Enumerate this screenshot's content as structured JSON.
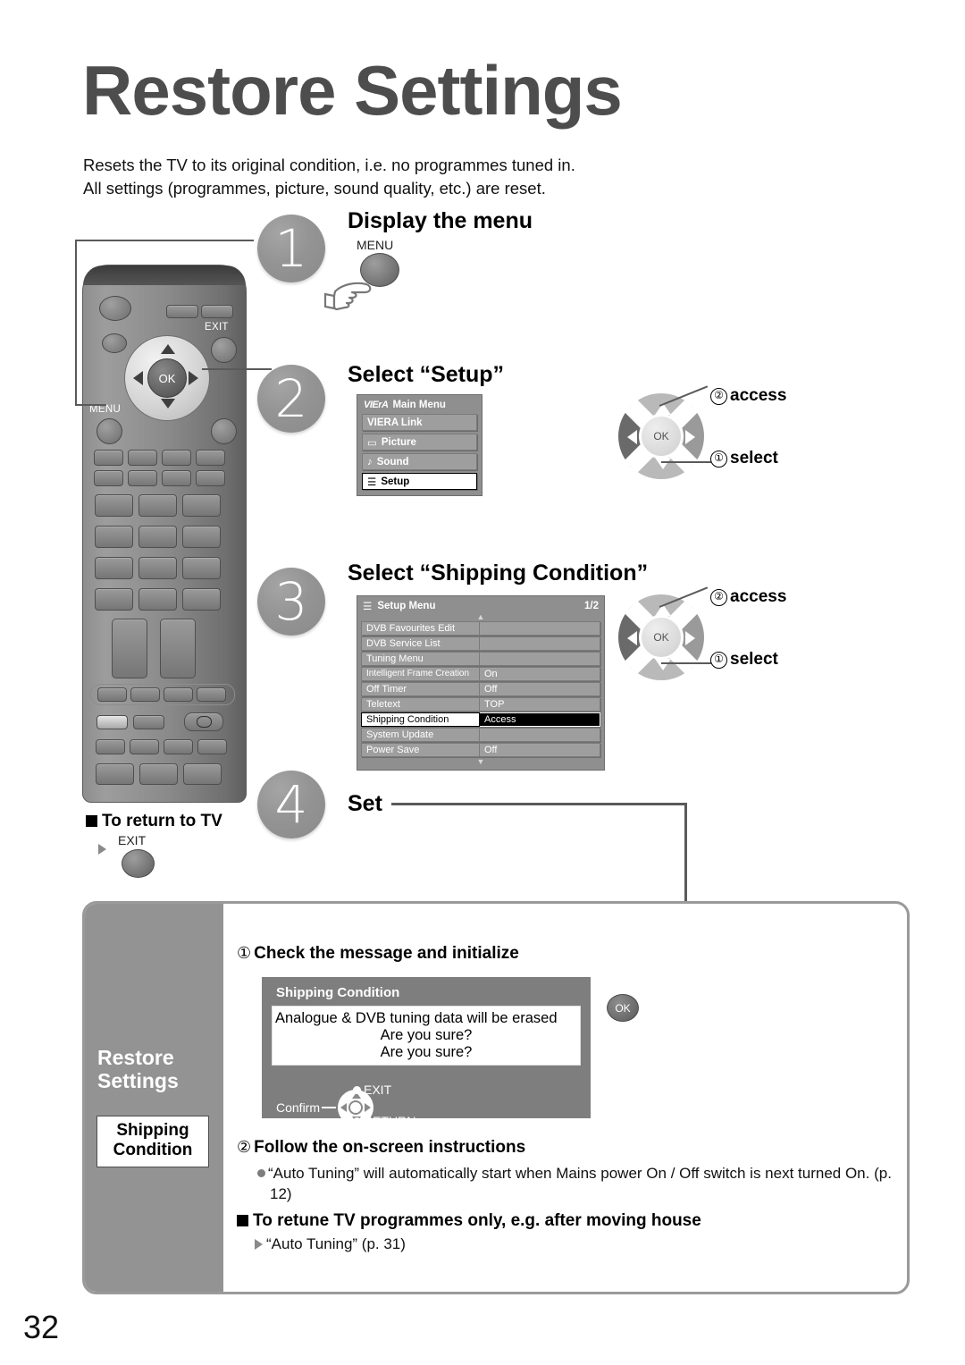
{
  "page": {
    "title": "Restore Settings",
    "intro_line1": "Resets the TV to its original condition, i.e. no programmes tuned in.",
    "intro_line2": "All settings (programmes, picture, sound quality, etc.) are reset.",
    "page_number": "32"
  },
  "steps": [
    {
      "number": "1",
      "heading": "Display the menu",
      "button_label": "MENU"
    },
    {
      "number": "2",
      "heading": "Select “Setup”"
    },
    {
      "number": "3",
      "heading": "Select “Shipping Condition”"
    },
    {
      "number": "4",
      "heading": "Set"
    }
  ],
  "remote": {
    "menu_label": "MENU",
    "exit_label": "EXIT",
    "ok_label": "OK"
  },
  "viera_menu": {
    "logo": "VIErA",
    "title": "Main Menu",
    "items": [
      {
        "label": "VIERA Link",
        "icon": "",
        "selected": false
      },
      {
        "label": "Picture",
        "icon": "▭",
        "selected": false
      },
      {
        "label": "Sound",
        "icon": "♪",
        "selected": false
      },
      {
        "label": "Setup",
        "icon": "☰",
        "selected": true
      }
    ]
  },
  "setup_menu": {
    "title": "Setup Menu",
    "page_indicator": "1/2",
    "rows": [
      {
        "label": "DVB Favourites Edit",
        "value": "",
        "selected": false
      },
      {
        "label": "DVB Service List",
        "value": "",
        "selected": false
      },
      {
        "label": "Tuning Menu",
        "value": "",
        "selected": false
      },
      {
        "label": "Intelligent Frame Creation",
        "value": "On",
        "selected": false
      },
      {
        "label": "Off Timer",
        "value": "Off",
        "selected": false
      },
      {
        "label": "Teletext",
        "value": "TOP",
        "selected": false
      },
      {
        "label": "Shipping Condition",
        "value": "Access",
        "selected": true
      },
      {
        "label": "System Update",
        "value": "",
        "selected": false
      },
      {
        "label": "Power Save",
        "value": "Off",
        "selected": false
      }
    ]
  },
  "nav_diagram": {
    "access_num": "②",
    "access_label": "access",
    "select_num": "①",
    "select_label": "select",
    "ok_label": "OK"
  },
  "return_to_tv": {
    "heading": "To return to TV",
    "button_label": "EXIT"
  },
  "sidebar": {
    "title_line1": "Restore",
    "title_line2": "Settings",
    "chip_line1": "Shipping",
    "chip_line2": "Condition"
  },
  "bottom": {
    "sub1_num": "①",
    "sub1_heading": "Check the message and initialize",
    "sub2_num": "②",
    "sub2_heading": "Follow the on-screen instructions",
    "bullet1": "“Auto Tuning” will automatically start when Mains power On / Off switch is next turned On. (p. 12)",
    "sub3_heading": "To retune TV programmes only, e.g. after moving house",
    "sub3_link": "“Auto Tuning” (p. 31)"
  },
  "dialog": {
    "title": "Shipping Condition",
    "message_line1": "Analogue & DVB tuning data will be erased",
    "message_line2": "Are you sure?",
    "message_line3": "Are you sure?",
    "confirm_label": "Confirm",
    "exit_label": "EXIT",
    "return_label": "RETURN",
    "ok_label": "OK"
  }
}
